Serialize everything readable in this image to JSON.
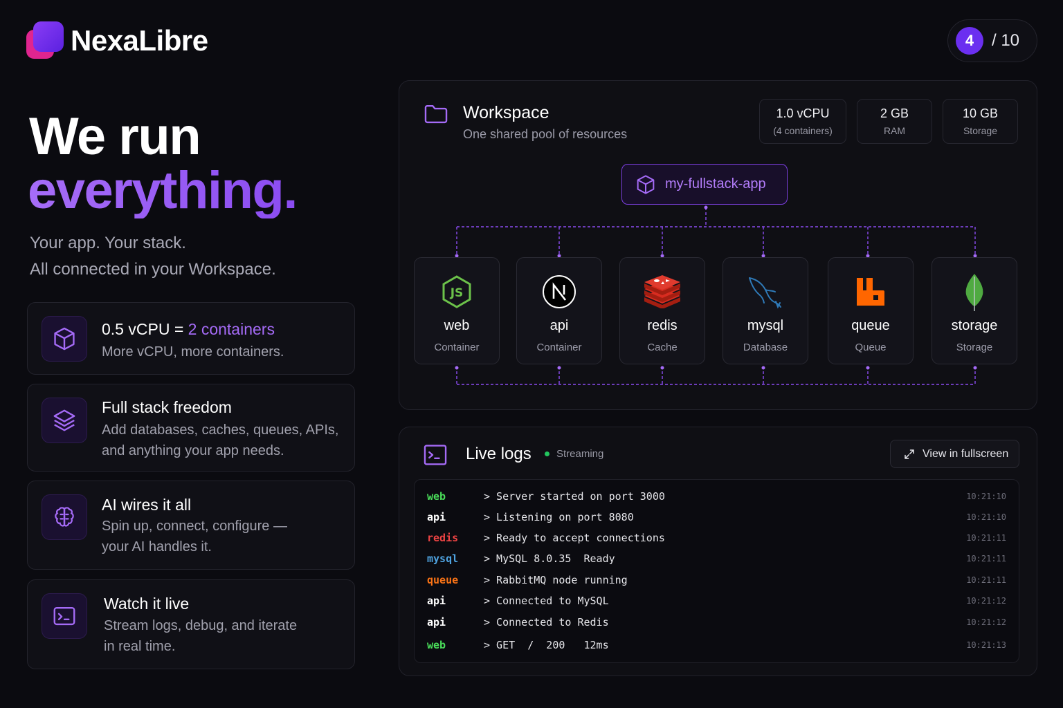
{
  "brand": {
    "name": "NexaLibre"
  },
  "pager": {
    "current": "4",
    "total": "/ 10"
  },
  "hero": {
    "line1": "We run",
    "line2": "everything.",
    "sub1": "Your app. Your stack.",
    "sub2": "All connected in your Workspace."
  },
  "features": [
    {
      "title_pre": "0.5 vCPU = ",
      "title_hl": "2 containers",
      "desc1": "More vCPU, more containers.",
      "desc2": "",
      "icon": "cube-icon"
    },
    {
      "title": "Full stack freedom",
      "desc1": "Add databases, caches, queues, APIs,",
      "desc2": "and anything your app needs.",
      "icon": "layers-icon"
    },
    {
      "title": "AI wires it all",
      "desc1": "Spin up, connect, configure —",
      "desc2": "your AI handles it.",
      "icon": "brain-icon"
    },
    {
      "title": "Watch it live",
      "desc1": "Stream logs, debug, and iterate",
      "desc2": "in real time.",
      "icon": "terminal-icon"
    }
  ],
  "workspace": {
    "title": "Workspace",
    "subtitle": "One shared pool of resources",
    "stats": [
      {
        "value": "1.0 vCPU",
        "label": "(4 containers)"
      },
      {
        "value": "2 GB",
        "label": "RAM"
      },
      {
        "value": "10 GB",
        "label": "Storage"
      }
    ],
    "app": "my-fullstack-app",
    "services": [
      {
        "name": "web",
        "kind": "Container",
        "icon": "nodejs-icon"
      },
      {
        "name": "api",
        "kind": "Container",
        "icon": "nextjs-icon"
      },
      {
        "name": "redis",
        "kind": "Cache",
        "icon": "redis-icon"
      },
      {
        "name": "mysql",
        "kind": "Database",
        "icon": "mysql-dolphin-icon"
      },
      {
        "name": "queue",
        "kind": "Queue",
        "icon": "rabbitmq-icon"
      },
      {
        "name": "storage",
        "kind": "Storage",
        "icon": "mongodb-leaf-icon"
      }
    ]
  },
  "logs": {
    "title": "Live logs",
    "status": "Streaming",
    "fullscreen": "View in fullscreen",
    "rows": [
      {
        "src": "web",
        "color": "#4ade5a",
        "msg": "> Server started on port 3000",
        "ts": "10:21:10"
      },
      {
        "src": "api",
        "color": "#ffffff",
        "msg": "> Listening on port 8080",
        "ts": "10:21:10"
      },
      {
        "src": "redis",
        "color": "#ef4444",
        "msg": "> Ready to accept connections",
        "ts": "10:21:11"
      },
      {
        "src": "mysql",
        "color": "#4fa3e0",
        "msg": "> MySQL 8.0.35  Ready",
        "ts": "10:21:11"
      },
      {
        "src": "queue",
        "color": "#f97316",
        "msg": "> RabbitMQ node running",
        "ts": "10:21:11"
      },
      {
        "src": "api",
        "color": "#ffffff",
        "msg": "> Connected to MySQL",
        "ts": "10:21:12"
      },
      {
        "src": "api",
        "color": "#ffffff",
        "msg": "> Connected to Redis",
        "ts": "10:21:12"
      },
      {
        "src": "web",
        "color": "#4ade5a",
        "msg": "> GET  /  200   12ms",
        "ts": "10:21:13"
      }
    ]
  }
}
